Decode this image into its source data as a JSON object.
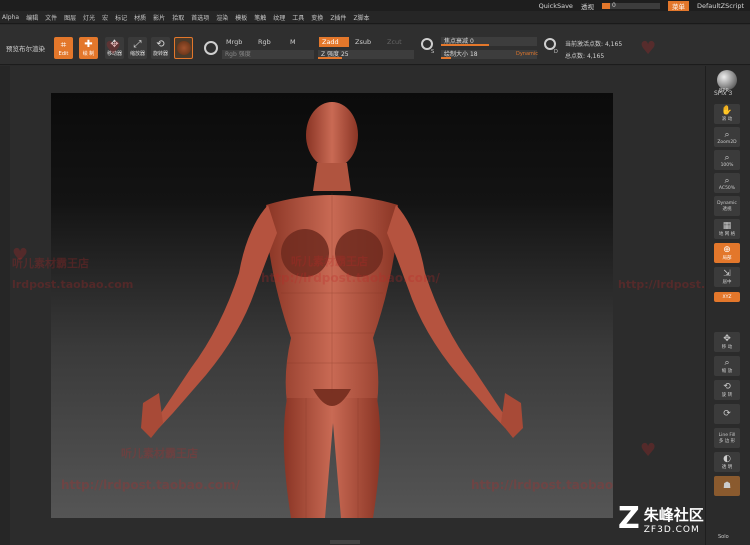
{
  "titlebar": {
    "quicksave": "QuickSave",
    "transparency_label": "透视",
    "transparency_value": "0",
    "menu_button": "菜单",
    "script_name": "DefaultZScript"
  },
  "menu": [
    "Alpha",
    "编辑",
    "文件",
    "图层",
    "灯光",
    "宏",
    "标记",
    "材质",
    "影片",
    "拾取",
    "首选项",
    "渲染",
    "模板",
    "笔触",
    "纹理",
    "工具",
    "变换",
    "Z插件",
    "Z脚本"
  ],
  "toolbar": {
    "preview_render": "预览布尔渲染",
    "edit": "Edit",
    "draw": "绘 制",
    "move": "移动器",
    "scale": "缩放器",
    "rotate": "旋转器",
    "mrgb": "Mrgb",
    "rgb": "Rgb",
    "m": "M",
    "zadd": "Zadd",
    "zsub": "Zsub",
    "zcut": "Zcut",
    "rgb_intensity": "Rgb 强度",
    "z_intensity_label": "Z 强度",
    "z_intensity_value": "25",
    "focal_shift_label": "焦点衰减",
    "focal_shift_value": "0",
    "draw_size_label": "绘制大小",
    "draw_size_value": "18",
    "dynamic": "Dynamic",
    "active_points_label": "当前激活点数:",
    "active_points_value": "4,165",
    "total_points_label": "总点数:",
    "total_points_value": "4,165",
    "s_letter": "S",
    "d_letter": "D"
  },
  "shelf": {
    "bpr": "BPR",
    "spix_label": "SPix",
    "spix_value": "3",
    "scroll": "滚 动",
    "zoom2d": "Zoom2D",
    "zoom100": "100%",
    "ac50": "AC50%",
    "dynamic": "Dynamic",
    "perspective": "透视",
    "floor": "地 网 格",
    "local": "局部",
    "xyz": "XYZ",
    "frame": "居中",
    "move": "移 动",
    "zoom3d": "缩 放",
    "rotate": "旋 转",
    "linefill": "Line Fill",
    "polyf": "多 边 形",
    "transp": "透 明",
    "ghost": "Ghost",
    "solo": "Solo"
  },
  "watermarks": {
    "url": "http://lrdpost.taobao.com/",
    "shop": "听儿素材霸王店",
    "url_short": "lrdpost.taobao.com"
  },
  "logo": {
    "cn": "朱峰社区",
    "en": "ZF3D.COM",
    "mark": "Z"
  },
  "colors": {
    "accent": "#e3772b",
    "model": "#b5533f"
  }
}
